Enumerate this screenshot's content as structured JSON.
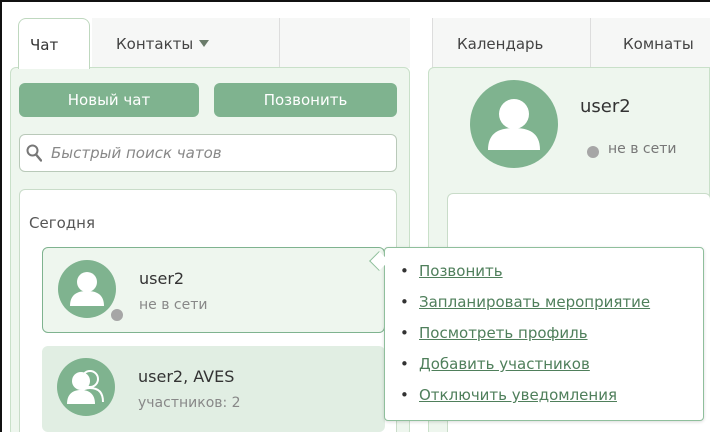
{
  "left_tabs": [
    {
      "label": "Чат"
    },
    {
      "label": "Контакты"
    }
  ],
  "right_tabs": [
    {
      "label": "Календарь"
    },
    {
      "label": "Комнаты"
    }
  ],
  "toolbar": {
    "new_chat": "Новый чат",
    "call": "Позвонить"
  },
  "search": {
    "placeholder": "Быстрый поиск чатов"
  },
  "chat_list": {
    "section_title": "Сегодня",
    "items": [
      {
        "name": "user2",
        "sub": "не в сети"
      },
      {
        "name": "user2, AVES",
        "sub": "участников: 2"
      }
    ]
  },
  "contact_header": {
    "name": "user2",
    "status": "не в сети"
  },
  "context_menu": {
    "items": [
      {
        "label": "Позвонить"
      },
      {
        "label": "Запланировать мероприятие"
      },
      {
        "label": "Посмотреть профиль"
      },
      {
        "label": "Добавить участников"
      },
      {
        "label": "Отключить уведомления"
      }
    ]
  },
  "colors": {
    "accent": "#7fb38f",
    "panel": "#eef6ee",
    "link": "#4f7f5b",
    "offline": "#a6a6a6"
  }
}
